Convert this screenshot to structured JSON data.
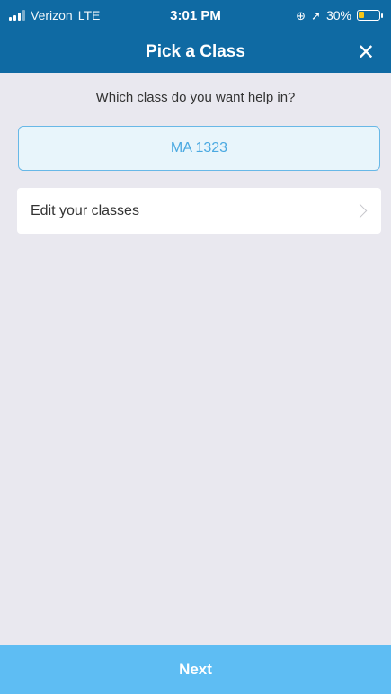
{
  "status_bar": {
    "carrier": "Verizon",
    "network": "LTE",
    "time": "3:01 PM",
    "battery": "30%",
    "battery_level": 0.3,
    "icons": [
      "signal-icon",
      "alarm-icon",
      "location-arrow-icon",
      "battery-icon"
    ]
  },
  "nav": {
    "title": "Pick a Class",
    "close_icon": "✕"
  },
  "main": {
    "prompt": "Which class do you want help in?",
    "selected_class": "MA 1323",
    "edit_classes_label": "Edit your classes"
  },
  "footer": {
    "next_label": "Next"
  },
  "colors": {
    "header": "#0f6aa3",
    "background": "#e9e8ef",
    "accent": "#5ebdf3",
    "selected_border": "#68b8e7",
    "selected_text": "#4aa9e1"
  }
}
